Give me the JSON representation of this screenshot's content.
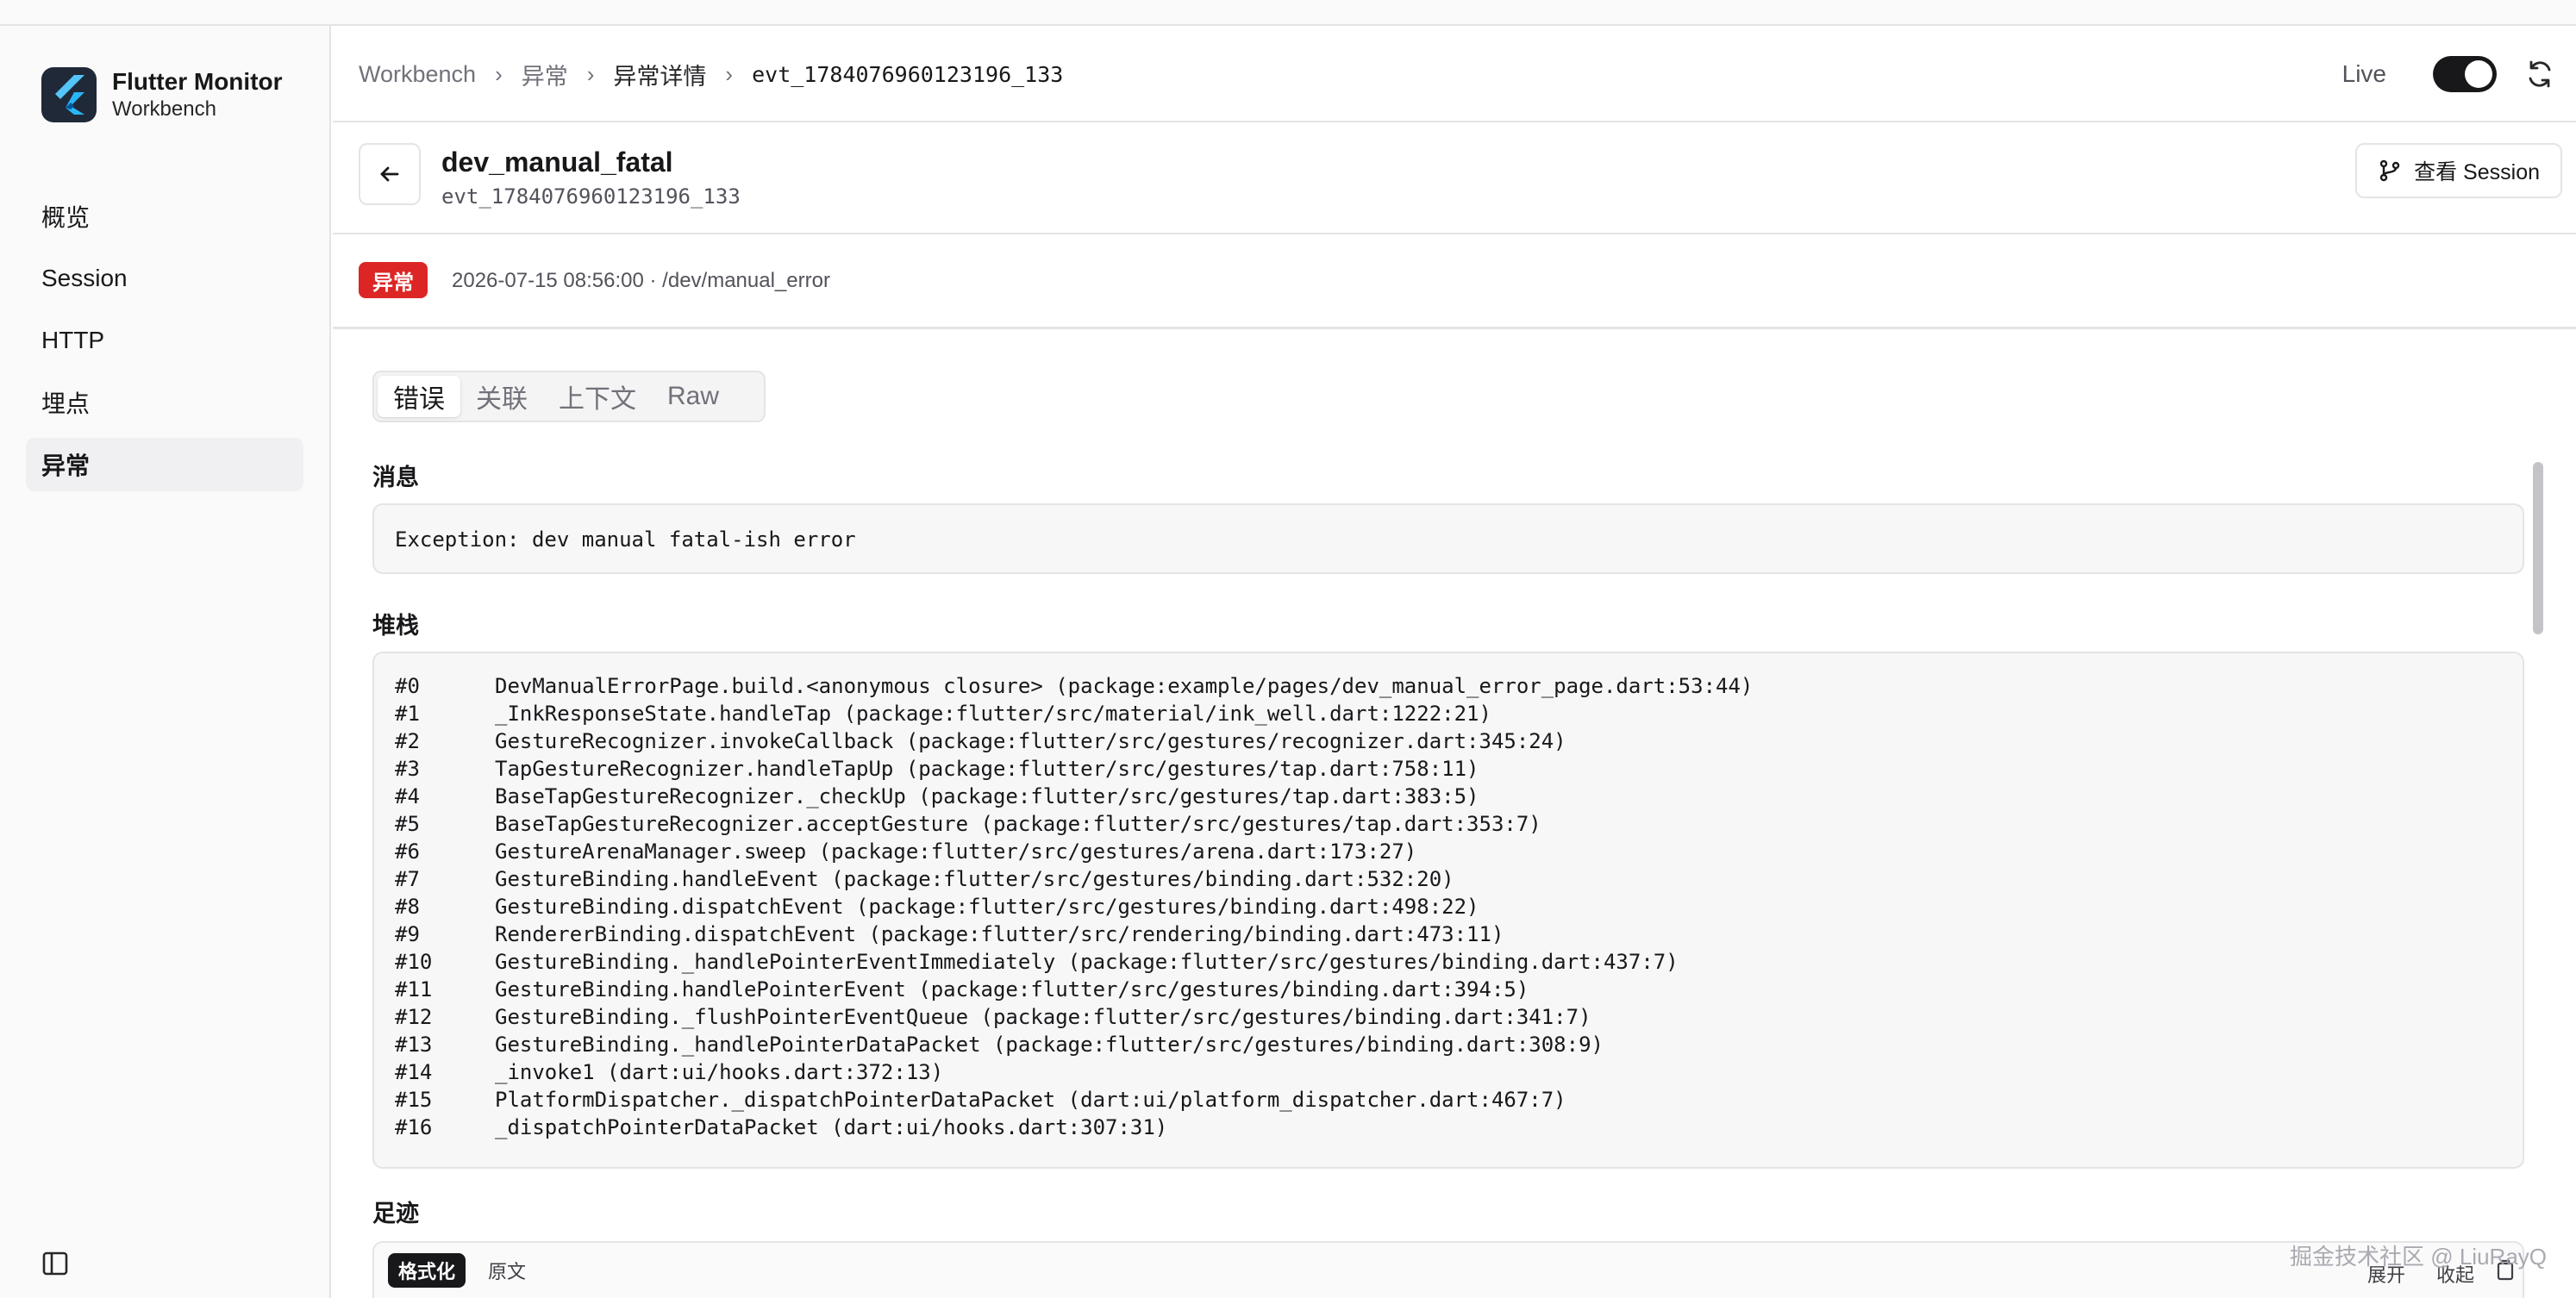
{
  "app": {
    "title": "Flutter Monitor",
    "subtitle": "Workbench"
  },
  "sidebar": {
    "items": [
      {
        "label": "概览",
        "active": false
      },
      {
        "label": "Session",
        "active": false
      },
      {
        "label": "HTTP",
        "active": false
      },
      {
        "label": "埋点",
        "active": false
      },
      {
        "label": "异常",
        "active": true
      }
    ]
  },
  "breadcrumb": [
    "Workbench",
    "异常",
    "异常详情",
    "evt_1784076960123196_133"
  ],
  "header": {
    "live_label": "Live",
    "live_on": true
  },
  "event": {
    "name": "dev_manual_fatal",
    "id": "evt_1784076960123196_133",
    "view_session_label": "查看 Session",
    "badge": "异常",
    "badge_color": "#dc2626",
    "meta": "2026-07-15 08:56:00 · /dev/manual_error"
  },
  "tabs": [
    {
      "label": "错误",
      "active": true
    },
    {
      "label": "关联",
      "active": false
    },
    {
      "label": "上下文",
      "active": false
    },
    {
      "label": "Raw",
      "active": false
    }
  ],
  "sections": {
    "message_label": "消息",
    "message": "Exception: dev manual fatal-ish error",
    "stack_label": "堆栈",
    "stack": [
      {
        "n": "#0",
        "t": "DevManualErrorPage.build.<anonymous closure> (package:example/pages/dev_manual_error_page.dart:53:44)"
      },
      {
        "n": "#1",
        "t": "_InkResponseState.handleTap (package:flutter/src/material/ink_well.dart:1222:21)"
      },
      {
        "n": "#2",
        "t": "GestureRecognizer.invokeCallback (package:flutter/src/gestures/recognizer.dart:345:24)"
      },
      {
        "n": "#3",
        "t": "TapGestureRecognizer.handleTapUp (package:flutter/src/gestures/tap.dart:758:11)"
      },
      {
        "n": "#4",
        "t": "BaseTapGestureRecognizer._checkUp (package:flutter/src/gestures/tap.dart:383:5)"
      },
      {
        "n": "#5",
        "t": "BaseTapGestureRecognizer.acceptGesture (package:flutter/src/gestures/tap.dart:353:7)"
      },
      {
        "n": "#6",
        "t": "GestureArenaManager.sweep (package:flutter/src/gestures/arena.dart:173:27)"
      },
      {
        "n": "#7",
        "t": "GestureBinding.handleEvent (package:flutter/src/gestures/binding.dart:532:20)"
      },
      {
        "n": "#8",
        "t": "GestureBinding.dispatchEvent (package:flutter/src/gestures/binding.dart:498:22)"
      },
      {
        "n": "#9",
        "t": "RendererBinding.dispatchEvent (package:flutter/src/rendering/binding.dart:473:11)"
      },
      {
        "n": "#10",
        "t": "GestureBinding._handlePointerEventImmediately (package:flutter/src/gestures/binding.dart:437:7)"
      },
      {
        "n": "#11",
        "t": "GestureBinding.handlePointerEvent (package:flutter/src/gestures/binding.dart:394:5)"
      },
      {
        "n": "#12",
        "t": "GestureBinding._flushPointerEventQueue (package:flutter/src/gestures/binding.dart:341:7)"
      },
      {
        "n": "#13",
        "t": "GestureBinding._handlePointerDataPacket (package:flutter/src/gestures/binding.dart:308:9)"
      },
      {
        "n": "#14",
        "t": "_invoke1 (dart:ui/hooks.dart:372:13)"
      },
      {
        "n": "#15",
        "t": "PlatformDispatcher._dispatchPointerDataPacket (dart:ui/platform_dispatcher.dart:467:7)"
      },
      {
        "n": "#16",
        "t": "_dispatchPointerDataPacket (dart:ui/hooks.dart:307:31)"
      }
    ],
    "footprint_label": "足迹",
    "footprint_tabs": [
      "格式化",
      "原文"
    ],
    "footprint_actions": [
      "展开",
      "收起"
    ]
  },
  "watermark": "掘金技术社区 @ LiuRayQ"
}
